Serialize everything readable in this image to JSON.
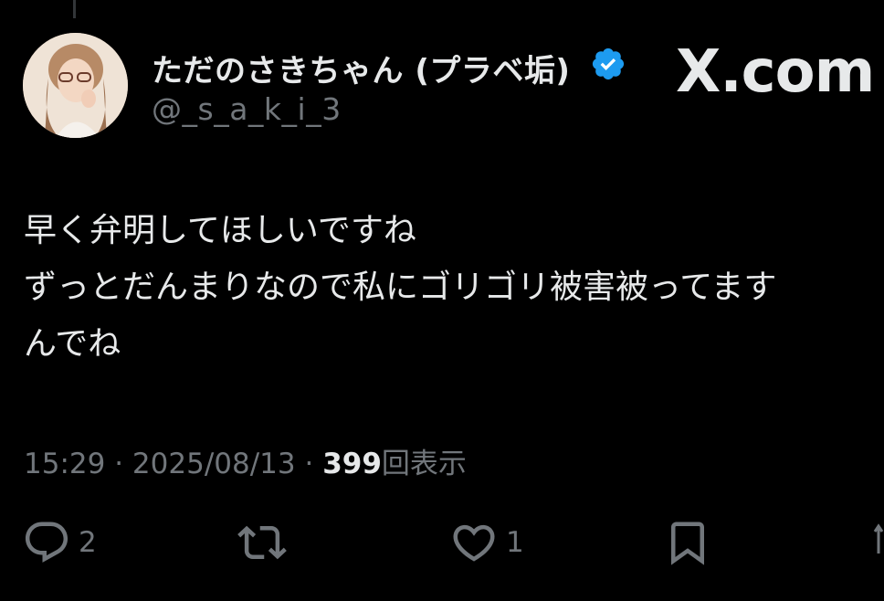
{
  "post": {
    "display_name": "ただのさきちゃん (プラベ垢)",
    "handle": "@_s_a_k_i_3",
    "verified_icon": "verified-badge-icon",
    "watermark": "X.com",
    "text_lines": [
      "早く弁明してほしいですね",
      "ずっとだんまりなので私にゴリゴリ被害被ってます",
      "んでね"
    ],
    "time": "15:29",
    "separator": "·",
    "date": "2025/08/13",
    "views_count": "399",
    "views_label": "回表示"
  },
  "actions": {
    "reply_count": "2",
    "repost_count": "",
    "like_count": "1"
  },
  "colors": {
    "background": "#000000",
    "primary_text": "#e7e9ea",
    "secondary_text": "#71767b",
    "verified": "#1d9bf0"
  }
}
